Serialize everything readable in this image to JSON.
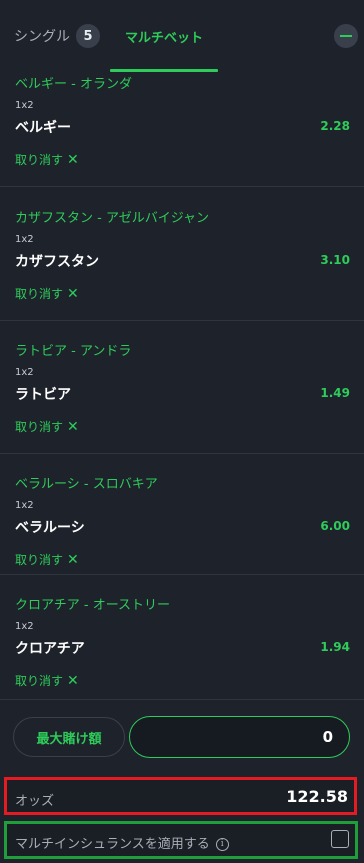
{
  "tabs": {
    "single_label": "シングル",
    "single_count": "5",
    "multi_label": "マルチベット"
  },
  "selections": [
    {
      "match": "ベルギー - オランダ",
      "market": "1x2",
      "pick": "ベルギー",
      "odds": "2.28",
      "remove_label": "取り消す"
    },
    {
      "match": "カザフスタン - アゼルバイジャン",
      "market": "1x2",
      "pick": "カザフスタン",
      "odds": "3.10",
      "remove_label": "取り消す"
    },
    {
      "match": "ラトビア - アンドラ",
      "market": "1x2",
      "pick": "ラトビア",
      "odds": "1.49",
      "remove_label": "取り消す"
    },
    {
      "match": "ベラルーシ - スロバキア",
      "market": "1x2",
      "pick": "ベラルーシ",
      "odds": "6.00",
      "remove_label": "取り消す"
    },
    {
      "match": "クロアチア - オーストリー",
      "market": "1x2",
      "pick": "クロアチア",
      "odds": "1.94",
      "remove_label": "取り消す"
    }
  ],
  "stake": {
    "max_label": "最大賭け額",
    "value": "0"
  },
  "summary": {
    "odds_label": "オッズ",
    "odds_value": "122.58",
    "insurance_label": "マルチインシュランスを適用する",
    "info_glyph": "i"
  },
  "colors": {
    "accent": "#2ecc5a",
    "background": "#1e222b",
    "highlight_red": "#e51b23",
    "highlight_green": "#1f9e3a"
  }
}
